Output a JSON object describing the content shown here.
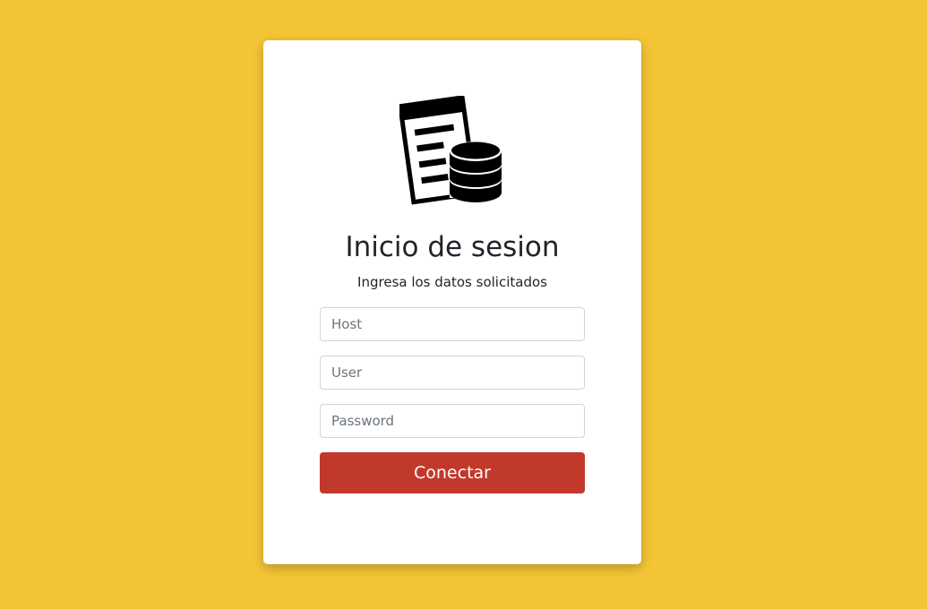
{
  "login": {
    "logo_icon": "document-database-icon",
    "title": "Inicio de sesion",
    "subtitle": "Ingresa los datos solicitados",
    "fields": {
      "host": {
        "placeholder": "Host",
        "value": ""
      },
      "user": {
        "placeholder": "User",
        "value": ""
      },
      "password": {
        "placeholder": "Password",
        "value": ""
      }
    },
    "submit_label": "Conectar"
  },
  "colors": {
    "background": "#f3c536",
    "card": "#ffffff",
    "button": "#c0392b",
    "text": "#212529"
  }
}
